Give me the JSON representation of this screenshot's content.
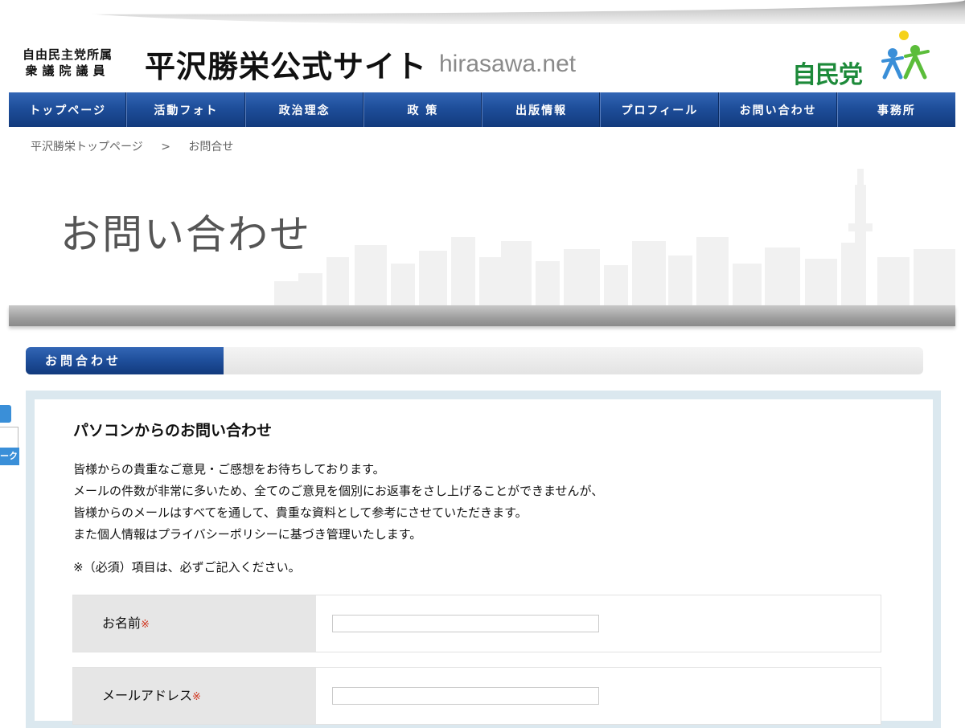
{
  "header": {
    "affiliation_line1": "自由民主党所属",
    "affiliation_line2": "衆議院議員",
    "site_title": "平沢勝栄公式サイト",
    "domain": "hirasawa.net",
    "party_logo_text": "自民党"
  },
  "nav": {
    "items": [
      {
        "label": "トップページ"
      },
      {
        "label": "活動フォト"
      },
      {
        "label": "政治理念"
      },
      {
        "label": "政 策"
      },
      {
        "label": "出版情報"
      },
      {
        "label": "プロフィール"
      },
      {
        "label": "お問い合わせ"
      },
      {
        "label": "事務所"
      }
    ]
  },
  "breadcrumb": {
    "home": "平沢勝栄トップページ",
    "separator": ">",
    "current": "お問合せ"
  },
  "hero": {
    "title": "お問い合わせ"
  },
  "section": {
    "tab_label": "お問合わせ"
  },
  "sidebar_widget": {
    "label_fragment": "ーク"
  },
  "content": {
    "heading": "パソコンからのお問い合わせ",
    "paragraph": [
      "皆様からの貴重なご意見・ご感想をお待ちしております。",
      "メールの件数が非常に多いため、全てのご意見を個別にお返事をさし上げることができませんが、",
      "皆様からのメールはすべてを通して、貴重な資料として参考にさせていただきます。",
      "また個人情報はプライバシーポリシーに基づき管理いたします。"
    ],
    "required_note": "※（必須）項目は、必ずご記入ください。"
  },
  "form": {
    "name_label": "お名前",
    "name_value": "",
    "email_label": "メールアドレス",
    "email_value": "",
    "required_mark": "※"
  },
  "colors": {
    "nav_blue": "#1e4e9a",
    "party_green": "#1d8a3a",
    "required_red": "#d0331c"
  }
}
